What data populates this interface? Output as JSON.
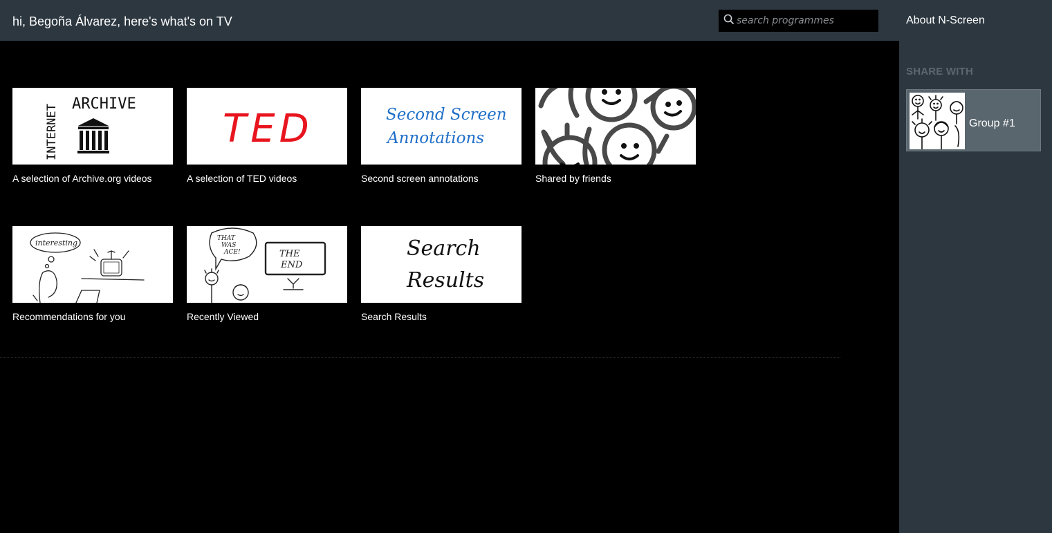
{
  "header": {
    "greeting": "hi, Begoña Álvarez, here's what's on TV",
    "search_placeholder": "search programmes"
  },
  "sidebar": {
    "about_link": "About N-Screen",
    "share_heading": "SHARE WITH",
    "groups": [
      {
        "label": "Group #1"
      }
    ]
  },
  "collections": [
    {
      "label": "A selection of Archive.org videos",
      "thumb_text": [
        "INTERNET",
        "ARCHIVE"
      ]
    },
    {
      "label": "A selection of TED videos",
      "thumb_text": [
        "TED"
      ]
    },
    {
      "label": "Second screen annotations",
      "thumb_text": [
        "Second Screen",
        "Annotations"
      ]
    },
    {
      "label": "Shared by friends",
      "thumb_text": []
    },
    {
      "label": "Recommendations for you",
      "thumb_text": [
        "interesting"
      ]
    },
    {
      "label": "Recently Viewed",
      "thumb_text": [
        "THAT WAS ACE!",
        "THE END"
      ]
    },
    {
      "label": "Search Results",
      "thumb_text": [
        "Search",
        "Results"
      ]
    }
  ],
  "colors": {
    "header_bg": "#2c3740",
    "ted_red": "#e8141e",
    "annotation_blue": "#1f6fc8",
    "group_card_bg": "#5a666e"
  }
}
